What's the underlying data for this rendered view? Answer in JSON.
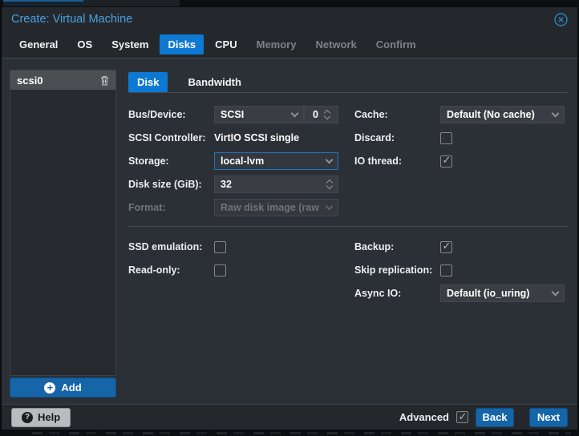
{
  "colors": {
    "accent_tab_blue": "#0e79d2",
    "button_blue": "#1565a8",
    "title_blue": "#4ba0e0",
    "focus_border": "#2175c4"
  },
  "window": {
    "title": "Create: Virtual Machine"
  },
  "wizard_tabs": [
    {
      "label": "General",
      "state": "enabled"
    },
    {
      "label": "OS",
      "state": "enabled"
    },
    {
      "label": "System",
      "state": "enabled"
    },
    {
      "label": "Disks",
      "state": "active"
    },
    {
      "label": "CPU",
      "state": "enabled"
    },
    {
      "label": "Memory",
      "state": "disabled"
    },
    {
      "label": "Network",
      "state": "disabled"
    },
    {
      "label": "Confirm",
      "state": "disabled"
    }
  ],
  "disk_panel": {
    "selected_item": "scsi0",
    "add_button": "Add"
  },
  "subtabs": [
    {
      "label": "Disk",
      "active": true
    },
    {
      "label": "Bandwidth",
      "active": false
    }
  ],
  "disk_form": {
    "bus_device": {
      "label": "Bus/Device:",
      "bus": "SCSI",
      "device": "0"
    },
    "scsi_controller": {
      "label": "SCSI Controller:",
      "value": "VirtIO SCSI single"
    },
    "storage": {
      "label": "Storage:",
      "value": "local-lvm",
      "focused": true
    },
    "disk_size": {
      "label": "Disk size (GiB):",
      "value": "32"
    },
    "format": {
      "label": "Format:",
      "value": "Raw disk image (raw",
      "disabled": true
    },
    "cache": {
      "label": "Cache:",
      "value": "Default (No cache)"
    },
    "discard": {
      "label": "Discard:",
      "checked": false
    },
    "io_thread": {
      "label": "IO thread:",
      "checked": true
    },
    "ssd_emulation": {
      "label": "SSD emulation:",
      "checked": false
    },
    "read_only": {
      "label": "Read-only:",
      "checked": false
    },
    "backup": {
      "label": "Backup:",
      "checked": true
    },
    "skip_replication": {
      "label": "Skip replication:",
      "checked": false
    },
    "async_io": {
      "label": "Async IO:",
      "value": "Default (io_uring)"
    }
  },
  "footer": {
    "help": "Help",
    "advanced_label": "Advanced",
    "advanced_checked": true,
    "back": "Back",
    "next": "Next"
  }
}
